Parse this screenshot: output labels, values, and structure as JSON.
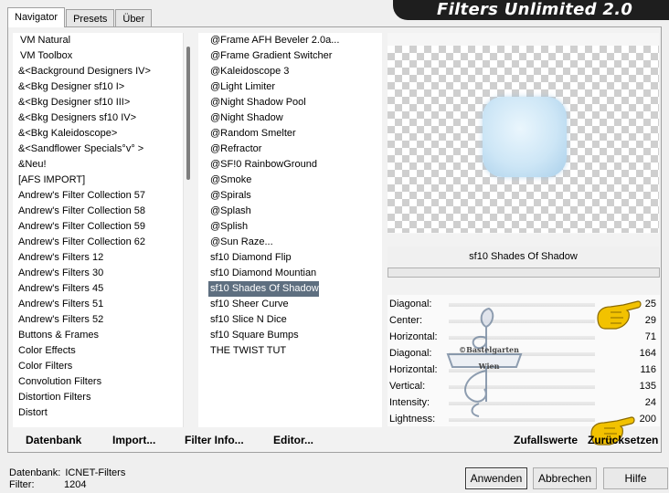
{
  "tabs": [
    {
      "label": "Navigator"
    },
    {
      "label": "Presets"
    },
    {
      "label": "Über"
    }
  ],
  "banner": {
    "title": "Filters Unlimited 2.0"
  },
  "categories": [
    "VM Natural",
    "VM Toolbox",
    "&<Background Designers IV>",
    "&<Bkg Designer sf10 I>",
    "&<Bkg Designer sf10 III>",
    "&<Bkg Designers sf10 IV>",
    "&<Bkg Kaleidoscope>",
    "&<Sandflower Specials°v° >",
    "&Neu!",
    "[AFS IMPORT]",
    "Andrew's Filter Collection 57",
    "Andrew's Filter Collection 58",
    "Andrew's Filter Collection 59",
    "Andrew's Filter Collection 62",
    "Andrew's Filters 12",
    "Andrew's Filters 30",
    "Andrew's Filters 45",
    "Andrew's Filters 51",
    "Andrew's Filters 52",
    "Buttons & Frames",
    "Color Effects",
    "Color Filters",
    "Convolution Filters",
    "Distortion Filters",
    "Distort"
  ],
  "filters": [
    "@Frame AFH Beveler 2.0a...",
    "@Frame Gradient Switcher",
    "@Kaleidoscope 3",
    "@Light Limiter",
    "@Night Shadow Pool",
    "@Night Shadow",
    "@Random Smelter",
    "@Refractor",
    "@SF!0 RainbowGround",
    "@Smoke",
    "@Spirals",
    "@Splash",
    "@Splish",
    "@Sun Raze...",
    "sf10 Diamond Flip",
    "sf10 Diamond Mountian",
    "sf10 Shades Of Shadow",
    "sf10 Sheer Curve",
    "sf10 Slice N Dice",
    "sf10 Square Bumps",
    "THE TWIST TUT"
  ],
  "selected_filter": "sf10 Shades Of Shadow",
  "params": [
    {
      "label": "Diagonal:",
      "value": "25"
    },
    {
      "label": "Center:",
      "value": "29"
    },
    {
      "label": "Horizontal:",
      "value": "71"
    },
    {
      "label": "Diagonal:",
      "value": "164"
    },
    {
      "label": "Horizontal:",
      "value": "116"
    },
    {
      "label": "Vertical:",
      "value": "135"
    },
    {
      "label": "Intensity:",
      "value": "24"
    },
    {
      "label": "Lightness:",
      "value": "200"
    }
  ],
  "watermark": {
    "line1": "©Bastelgarten",
    "line2": "Wien"
  },
  "buttons": {
    "datenbank": "Datenbank",
    "import": "Import...",
    "filter_info": "Filter Info...",
    "editor": "Editor...",
    "random": "Zufallswerte",
    "reset": "Zurücksetzen",
    "apply": "Anwenden",
    "cancel": "Abbrechen",
    "help": "Hilfe"
  },
  "status": {
    "db_label": "Datenbank:",
    "db_value": "ICNET-Filters",
    "filter_label": "Filter:",
    "filter_value": "1204"
  }
}
